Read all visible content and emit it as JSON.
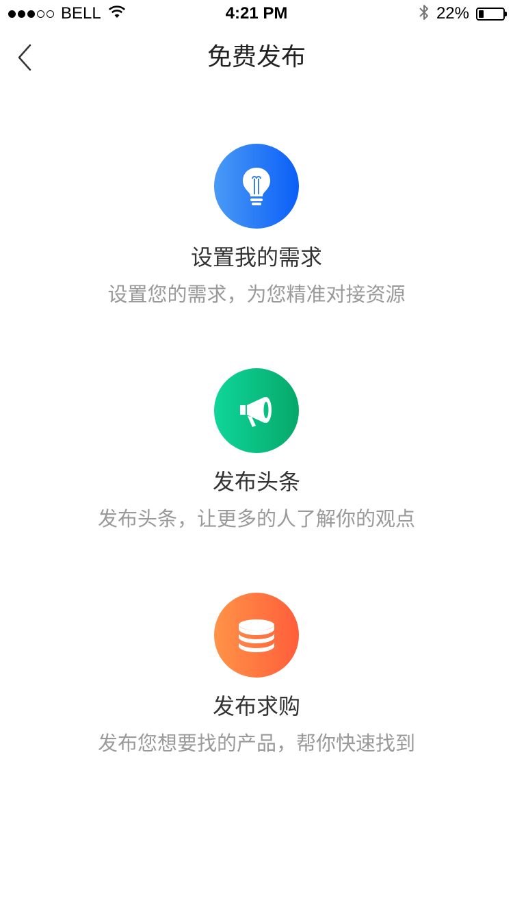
{
  "status_bar": {
    "carrier": "BELL",
    "time": "4:21 PM",
    "battery_percent_label": "22%",
    "battery_level": 0.22,
    "signal_bars_filled": 3,
    "signal_bars_total": 5
  },
  "nav": {
    "title": "免费发布",
    "back_icon": "chevron-left-icon"
  },
  "options": [
    {
      "title": "设置我的需求",
      "description": "设置您的需求，为您精准对接资源",
      "icon": "lightbulb-icon",
      "color_from": "#4a9af6",
      "color_to": "#0a5ff7"
    },
    {
      "title": "发布头条",
      "description": "发布头条，让更多的人了解你的观点",
      "icon": "megaphone-icon",
      "color_from": "#0fd69a",
      "color_to": "#06a869"
    },
    {
      "title": "发布求购",
      "description": "发布您想要找的产品，帮你快速找到",
      "icon": "coin-stack-icon",
      "color_from": "#ff9348",
      "color_to": "#ff5e3a"
    }
  ]
}
